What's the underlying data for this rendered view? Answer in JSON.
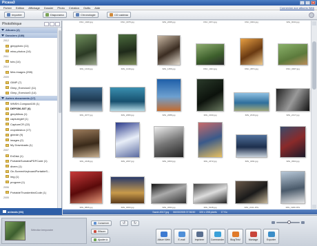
{
  "window": {
    "title": "Picasa3"
  },
  "menubar": {
    "items": [
      "Fichier",
      "Edition",
      "Affichage",
      "Dossier",
      "Photo",
      "Création",
      "Outils",
      "Aide"
    ],
    "login": "Connexion aux albums Web"
  },
  "toolbar": {
    "import": "Importer",
    "slideshow": "Diaporama",
    "timeline": "Chronologie",
    "cd": "CD cadeau"
  },
  "sidebar": {
    "title": "Photothèque",
    "rows": [
      {
        "kind": "grp",
        "label": "Albums (2)"
      },
      {
        "kind": "grp",
        "label": "Dossiers (180)"
      },
      {
        "kind": "yr",
        "label": "2012"
      },
      {
        "kind": "fld",
        "label": "gimpphoto (11)"
      },
      {
        "kind": "fld",
        "label": "miss-photos (14)"
      },
      {
        "kind": "yr",
        "label": "2011"
      },
      {
        "kind": "fld",
        "label": "tuts (14)"
      },
      {
        "kind": "yr",
        "label": "2010"
      },
      {
        "kind": "fld",
        "label": "Mes images (298)"
      },
      {
        "kind": "yr",
        "label": "2009"
      },
      {
        "kind": "fld",
        "label": "GIMP (7)"
      },
      {
        "kind": "fld",
        "label": "Gimp_Exercice2 (11)"
      },
      {
        "kind": "fld",
        "label": "Gimp_Exercice3 (14)"
      },
      {
        "kind": "grp",
        "label": "Autres documents (17)"
      },
      {
        "kind": "fld",
        "label": "WNSH-Compact100 (1)"
      },
      {
        "kind": "fld",
        "label": "DEPS56-53T (6)",
        "bold": true
      },
      {
        "kind": "fld",
        "label": "gimpMeas (1)"
      },
      {
        "kind": "fld",
        "label": "captureglef (1)"
      },
      {
        "kind": "fld",
        "label": "CaptureCR (22)"
      },
      {
        "kind": "fld",
        "label": "cropidesbox (17)"
      },
      {
        "kind": "fld",
        "label": "gteede (9)"
      },
      {
        "kind": "fld",
        "label": "images (2)"
      },
      {
        "kind": "fld",
        "label": "My Downloads (1)"
      },
      {
        "kind": "yr",
        "label": "2007"
      },
      {
        "kind": "fld",
        "label": "EnDisk (1)"
      },
      {
        "kind": "fld",
        "label": "PortableSumatraPDFCode (1)"
      },
      {
        "kind": "fld",
        "label": "divers (1)"
      },
      {
        "kind": "fld",
        "label": "On-ScreenKeyboardPortableS..."
      },
      {
        "kind": "fld",
        "label": "img (1)"
      },
      {
        "kind": "fld",
        "label": "program (1)"
      },
      {
        "kind": "yr",
        "label": "2006"
      },
      {
        "kind": "fld",
        "label": "PortableThunderbirdCode (1)"
      },
      {
        "kind": "yr",
        "label": "2005"
      }
    ],
    "footer": "animals (66)"
  },
  "grid": {
    "photos": [
      {
        "cap": "IMG_1440.jpg"
      },
      {
        "cap": "IMG_1449.jpg"
      },
      {
        "cap": "IMG_1456.jpg"
      },
      {
        "cap": "DSC_1021.jpg"
      },
      {
        "cap": "DSC_0871.jpg"
      },
      {
        "cap": "DSC_0007.jpg"
      },
      {
        "cap": "IMG_2077.jpg"
      },
      {
        "cap": "IMG_2083.jpg"
      },
      {
        "cap": "IMG_2088.jpg"
      },
      {
        "cap": "IMG_2190.jpg"
      },
      {
        "cap": "IMG_2316.jpg"
      },
      {
        "cap": "IMG_2417.jpg"
      },
      {
        "cap": "IMG_2448.jpg"
      },
      {
        "cap": "IMG_2467.jpg"
      },
      {
        "cap": "IMG_0463.jpg"
      },
      {
        "cap": "IMG_2472.jpg"
      },
      {
        "cap": "IMG_4491.jpg"
      },
      {
        "cap": "IMG_3604.jpg"
      },
      {
        "cap": "IMG_8806.jpg"
      },
      {
        "cap": "IMG_3003.jpg"
      },
      {
        "cap": "IMG_3094.jpg"
      },
      {
        "cap": "IMG_5448.jpg"
      },
      {
        "cap": "IMG_2131.JPG"
      },
      {
        "cap": "IMG_1980.JPG"
      }
    ],
    "top_caps": [
      "DSC_1026.jpg",
      "DSC_0075.jpg",
      "IMG_2095.jpg",
      "DSC_0971.jpg",
      "DSC_0001.jpg",
      "IMG_0044.jpg"
    ]
  },
  "status": {
    "file": "Sarah-0017.jpg",
    "date": "06/03/2005 07:36:50",
    "size": "320 x 208 pixels",
    "kb": "17 Ko"
  },
  "tray": {
    "placeholder": "Sélection temporaire",
    "btn1": "Conserver",
    "btn2": "Effacer",
    "btn3": "Ajouter à",
    "share": [
      "Album Web",
      "E-mail",
      "Imprimer",
      "Commander",
      "BlogThis!",
      "Montage",
      "Exporter"
    ]
  },
  "colors": {
    "titlebar": "#2a5aa6",
    "selection": "#3d6fc2",
    "status": "#3d66a8"
  }
}
